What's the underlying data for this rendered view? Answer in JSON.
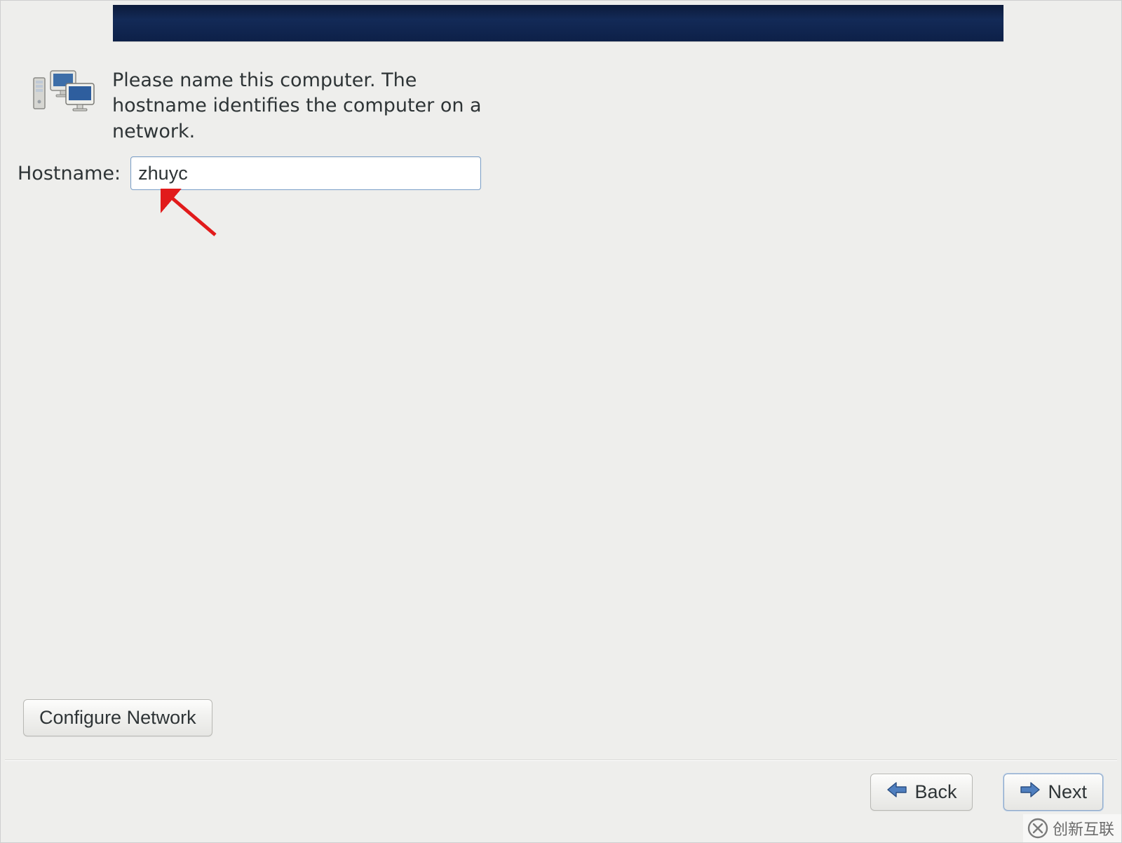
{
  "intro": {
    "text": "Please name this computer.  The hostname identifies the computer on a network."
  },
  "hostname": {
    "label": "Hostname:",
    "value": "zhuyc"
  },
  "buttons": {
    "configure_network": "Configure Network",
    "back": "Back",
    "next": "Next"
  },
  "watermark": {
    "text": "创新互联"
  },
  "colors": {
    "banner_start": "#0c1a3a",
    "banner_end": "#0d2048",
    "background": "#eeeeec",
    "input_border": "#7a9ec7",
    "annotation_arrow": "#e11b1b"
  }
}
